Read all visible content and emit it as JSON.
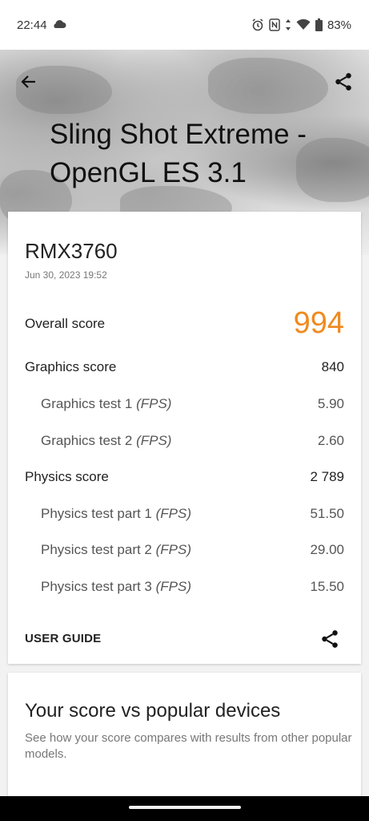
{
  "status": {
    "time": "22:44",
    "battery": "83%",
    "icons": [
      "cloud-icon",
      "alarm-icon",
      "nfc-icon",
      "data-arrows-icon",
      "wifi-icon",
      "battery-icon"
    ]
  },
  "header": {
    "title": "Sling Shot Extreme - OpenGL ES 3.1"
  },
  "result": {
    "device": "RMX3760",
    "date": "Jun 30, 2023 19:52",
    "overall_label": "Overall score",
    "overall_value": "994",
    "graphics_label": "Graphics score",
    "graphics_value": "840",
    "gt1_label": "Graphics test 1",
    "gt1_unit": "(FPS)",
    "gt1_value": "5.90",
    "gt2_label": "Graphics test 2",
    "gt2_unit": "(FPS)",
    "gt2_value": "2.60",
    "physics_label": "Physics score",
    "physics_value": "2 789",
    "pt1_label": "Physics test part 1",
    "pt1_unit": "(FPS)",
    "pt1_value": "51.50",
    "pt2_label": "Physics test part 2",
    "pt2_unit": "(FPS)",
    "pt2_value": "29.00",
    "pt3_label": "Physics test part 3",
    "pt3_unit": "(FPS)",
    "pt3_value": "15.50",
    "user_guide": "USER GUIDE"
  },
  "compare": {
    "title": "Your score vs popular devices",
    "description": "See how your score compares with results from other popular models."
  },
  "colors": {
    "accent": "#f08a1f"
  }
}
